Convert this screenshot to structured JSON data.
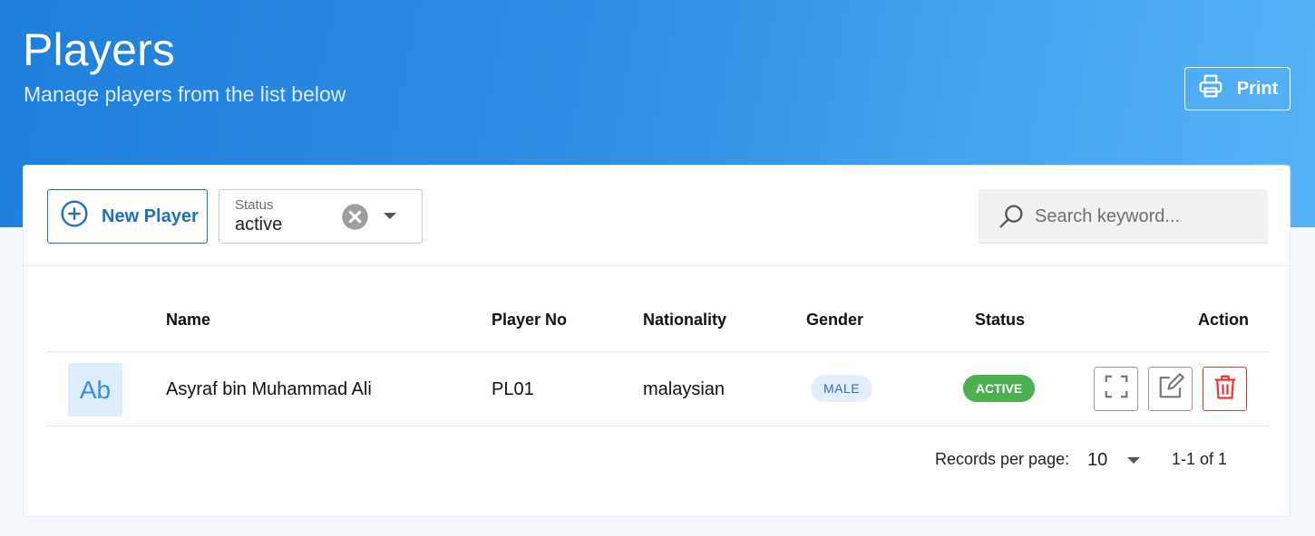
{
  "header": {
    "title": "Players",
    "subtitle": "Manage players from the list below",
    "print_label": "Print"
  },
  "toolbar": {
    "new_label": "New Player",
    "status_filter": {
      "label": "Status",
      "value": "active"
    },
    "search": {
      "placeholder": "Search keyword...",
      "value": ""
    }
  },
  "table": {
    "columns": {
      "name": "Name",
      "player_no": "Player No",
      "nationality": "Nationality",
      "gender": "Gender",
      "status": "Status",
      "action": "Action"
    },
    "rows": [
      {
        "avatar": "Ab",
        "name": "Asyraf bin Muhammad Ali",
        "player_no": "PL01",
        "nationality": "malaysian",
        "gender": "MALE",
        "status": "ACTIVE"
      }
    ]
  },
  "pagination": {
    "rows_per_page_label": "Records per page:",
    "rows_per_page": "10",
    "range": "1-1 of 1"
  },
  "icons": {
    "print": "printer-icon",
    "new": "plus-circle-icon",
    "clear": "close-circle-icon",
    "search": "search-icon",
    "view": "fullscreen-icon",
    "edit": "edit-icon",
    "delete": "trash-icon"
  },
  "colors": {
    "primary": "#1f6fbf",
    "header_gradient_start": "#1e7fdc",
    "header_gradient_end": "#55b2f6",
    "active": "#4caf50",
    "danger": "#e53935"
  }
}
